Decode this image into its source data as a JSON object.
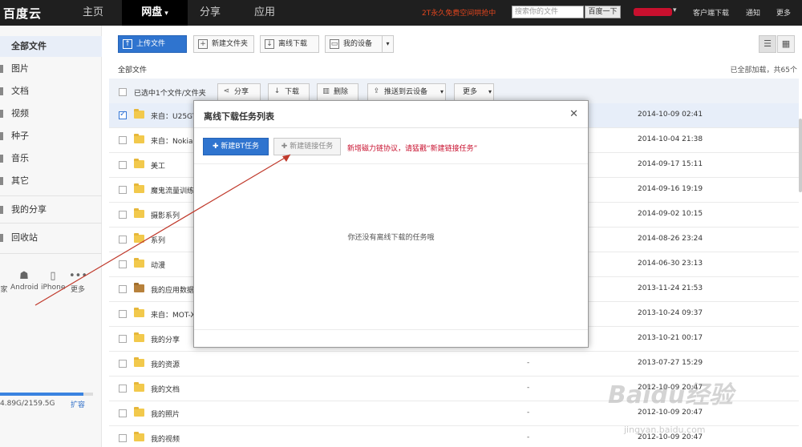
{
  "topbar": {
    "logo": "百度云",
    "nav": [
      {
        "label": "主页",
        "active": false
      },
      {
        "label": "网盘",
        "active": true
      },
      {
        "label": "分享",
        "active": false
      },
      {
        "label": "应用",
        "active": false
      }
    ],
    "promo": "2T永久免费空间哄抢中",
    "search_placeholder": "搜索你的文件",
    "search_button": "百度一下",
    "links": [
      "客户端下载",
      "通知",
      "更多"
    ]
  },
  "sidebar": {
    "items": [
      {
        "label": "全部文件",
        "active": true
      },
      {
        "label": "图片"
      },
      {
        "label": "文档"
      },
      {
        "label": "视频"
      },
      {
        "label": "种子"
      },
      {
        "label": "音乐"
      },
      {
        "label": "其它"
      }
    ],
    "share": "我的分享",
    "recycle": "回收站",
    "devices": [
      {
        "label": "家",
        "icon": "home-icon"
      },
      {
        "label": "Android",
        "icon": "android-icon"
      },
      {
        "label": "iPhone",
        "icon": "iphone-icon"
      },
      {
        "label": "更多",
        "icon": "more-icon"
      }
    ],
    "quota": {
      "text": "4.89G/2159.5G",
      "used_fraction": 0.9,
      "expand": "扩容"
    }
  },
  "toolbar": {
    "upload": "上传文件",
    "new_folder": "新建文件夹",
    "offline": "离线下载",
    "my_device": "我的设备"
  },
  "breadcrumb": "全部文件",
  "loaded_info": "已全部加载，共65个",
  "action_bar": {
    "selected": "已选中1个文件/文件夹",
    "share": "分享",
    "download": "下载",
    "delete": "删除",
    "push": "推送到云设备",
    "more": "更多"
  },
  "files": [
    {
      "name": "来自：U25GT",
      "size": "",
      "date": "2014-10-09 02:41",
      "selected": true,
      "kind": "folder"
    },
    {
      "name": "来自：Nokia",
      "size": "",
      "date": "2014-10-04 21:38",
      "kind": "folder"
    },
    {
      "name": "美工",
      "size": "",
      "date": "2014-09-17 15:11",
      "kind": "folder"
    },
    {
      "name": "魔鬼流量训练",
      "size": "",
      "date": "2014-09-16 19:19",
      "kind": "folder"
    },
    {
      "name": "摄影系列",
      "size": "",
      "date": "2014-09-02 10:15",
      "kind": "folder"
    },
    {
      "name": "系列",
      "size": "",
      "date": "2014-08-26 23:24",
      "kind": "folder"
    },
    {
      "name": "动漫",
      "size": "",
      "date": "2014-06-30 23:13",
      "kind": "folder"
    },
    {
      "name": "我的应用数据",
      "size": "",
      "date": "2013-11-24 21:53",
      "kind": "app"
    },
    {
      "name": "来自：MOT-X",
      "size": "",
      "date": "2013-10-24 09:37",
      "kind": "folder"
    },
    {
      "name": "我的分享",
      "size": "",
      "date": "2013-10-21 00:17",
      "kind": "folder"
    },
    {
      "name": "我的资源",
      "size": "-",
      "date": "2013-07-27 15:29",
      "kind": "folder"
    },
    {
      "name": "我的文档",
      "size": "-",
      "date": "2012-10-09 20:47",
      "kind": "folder"
    },
    {
      "name": "我的照片",
      "size": "-",
      "date": "2012-10-09 20:47",
      "kind": "folder"
    },
    {
      "name": "我的视频",
      "size": "-",
      "date": "2012-10-09 20:47",
      "kind": "folder"
    }
  ],
  "modal": {
    "title": "离线下载任务列表",
    "bt_button": "新建BT任务",
    "link_button": "新建链接任务",
    "hint": "新增磁力链协议，请猛戳“新建链接任务”",
    "empty": "你还没有离线下载的任务哦"
  },
  "watermark": {
    "main": "Baidu经验",
    "sub": "jingyan.baidu.com"
  },
  "colors": {
    "accent": "#2f74cf",
    "hint": "#c8102e",
    "promo": "#e0451e",
    "annotation_arrow": "#c0392b"
  }
}
